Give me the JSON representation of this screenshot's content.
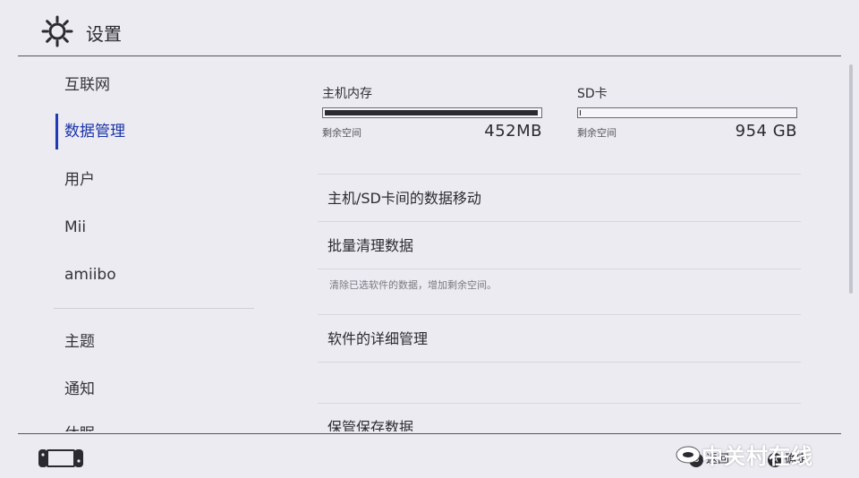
{
  "header": {
    "title": "设置",
    "icon": "gear-icon"
  },
  "sidebar": {
    "items": [
      {
        "label": "互联网"
      },
      {
        "label": "数据管理",
        "selected": true
      },
      {
        "label": "用户"
      },
      {
        "label": "Mii"
      },
      {
        "label": "amiibo"
      },
      {
        "label": "主题"
      },
      {
        "label": "通知"
      },
      {
        "label": "休眠"
      }
    ]
  },
  "storage": {
    "system": {
      "label": "主机内存",
      "free_label": "剩余空间",
      "free_value": "452MB",
      "used_fraction": 0.99
    },
    "sd": {
      "label": "SD卡",
      "free_label": "剩余空间",
      "free_value": "954 GB",
      "used_fraction": 0.004
    }
  },
  "menu": {
    "move_data": "主机/SD卡间的数据移动",
    "bulk_clean": "批量清理数据",
    "bulk_clean_desc": "清除已选软件的数据，增加剩余空间。",
    "software_manage": "软件的详细管理",
    "save_data": "保管保存数据"
  },
  "footer": {
    "back_button": "B",
    "back_label": "返回",
    "ok_button": "A",
    "ok_label": "确定"
  },
  "watermark": {
    "text": "中关村在线"
  },
  "colors": {
    "background": "#ecebf2",
    "accent": "#1e3bb3",
    "bar_fill": "#2a2a30"
  }
}
